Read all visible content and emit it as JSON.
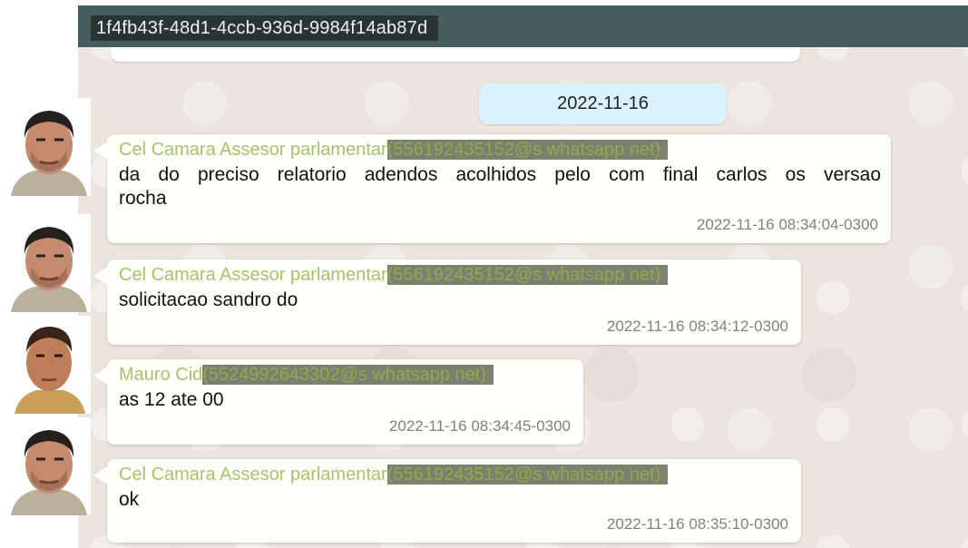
{
  "chat": {
    "id": "1f4fb43f-48d1-4ccb-936d-9984f14ab87d",
    "date_chip": "2022-11-16"
  },
  "messages": [
    {
      "sender": "Cel Camara Assesor parlamentar",
      "sender_number": "(556192435152@s whatsapp net)",
      "text_line1": "da do preciso relatorio adendos acolhidos pelo com final carlos os versao",
      "text_line2": "rocha",
      "timestamp": "2022-11-16 08:34:04-0300"
    },
    {
      "sender": "Cel Camara Assesor parlamentar",
      "sender_number": "(556192435152@s whatsapp net)",
      "text": "solicitacao sandro do",
      "timestamp": "2022-11-16 08:34:12-0300"
    },
    {
      "sender": "Mauro Cid",
      "sender_number": "(5524992643302@s whatsapp net)",
      "text": "as 12 ate 00",
      "timestamp": "2022-11-16 08:34:45-0300"
    },
    {
      "sender": "Cel Camara Assesor parlamentar",
      "sender_number": "(556192435152@s whatsapp net)",
      "text": "ok",
      "timestamp": "2022-11-16 08:35:10-0300"
    }
  ],
  "colors": {
    "header": "#455d5d",
    "chat_background": "#ece5dd",
    "date_chip": "#d9f2fb",
    "sender_name": "#a6c36a",
    "redaction_highlight": "#7c806f"
  },
  "icons": [
    "avatar-man-1-icon",
    "avatar-man-2-icon"
  ]
}
